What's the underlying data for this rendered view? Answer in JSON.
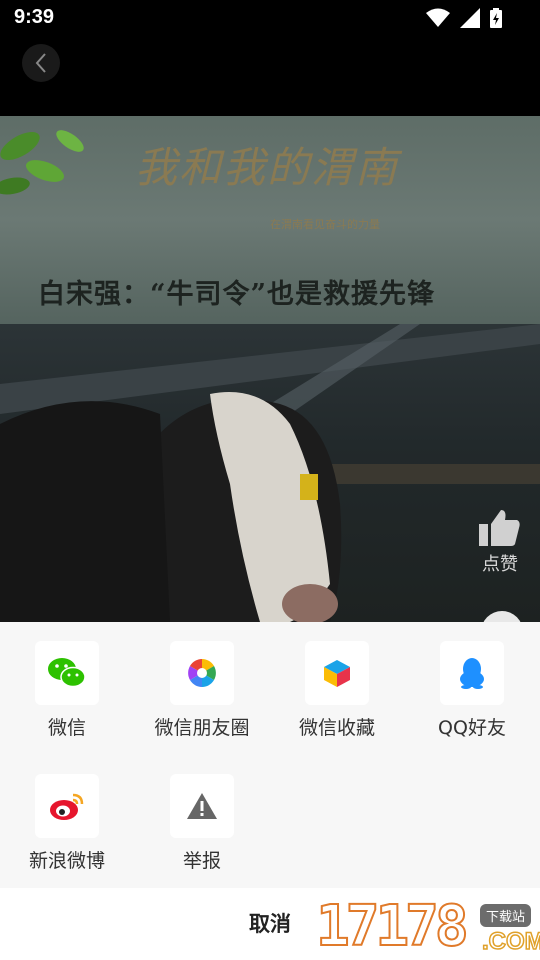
{
  "status_bar": {
    "time": "9:39"
  },
  "video": {
    "calligraphy_title": "我和我的渭南",
    "calligraphy_subtitle": "在渭南看见奋斗的力量",
    "headline": "白宋强：“牛司令”也是救援先锋"
  },
  "like": {
    "label": "点赞"
  },
  "share_sheet": {
    "items": [
      {
        "label": "微信",
        "icon": "wechat-icon"
      },
      {
        "label": "微信朋友圈",
        "icon": "moments-icon"
      },
      {
        "label": "微信收藏",
        "icon": "favorites-icon"
      },
      {
        "label": "QQ好友",
        "icon": "qq-icon"
      },
      {
        "label": "新浪微博",
        "icon": "weibo-icon"
      },
      {
        "label": "举报",
        "icon": "report-icon"
      }
    ],
    "cancel_label": "取消"
  },
  "watermark": {
    "digits": "17178",
    "tag": "下载站",
    "domain": ".COM"
  },
  "colors": {
    "wechat_green": "#2dc100",
    "qq_blue": "#1e90ff",
    "weibo_red": "#e6162d"
  }
}
